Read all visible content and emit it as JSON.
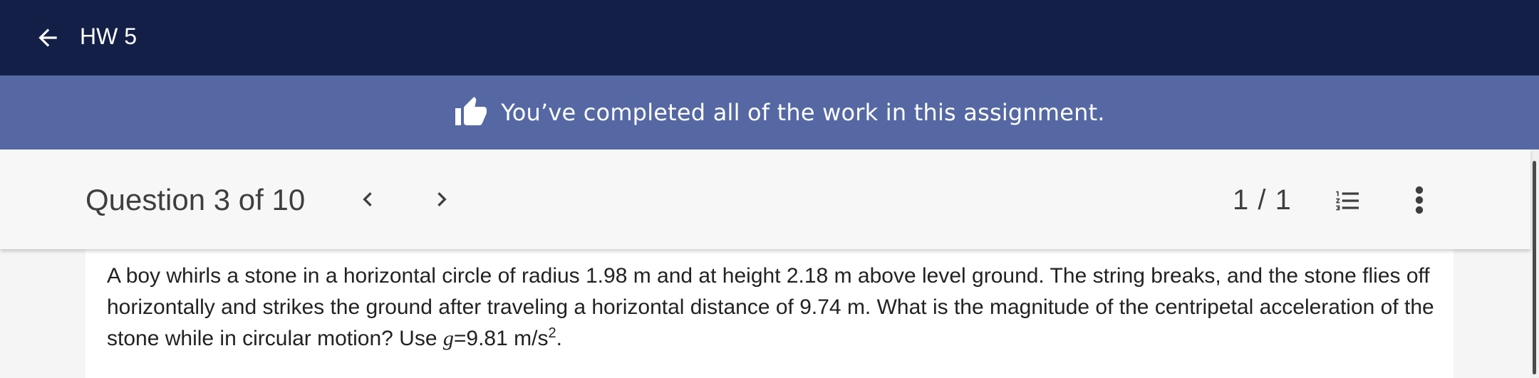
{
  "header": {
    "back_icon": "arrow-left-icon",
    "title": "HW 5"
  },
  "banner": {
    "icon": "thumbs-up-icon",
    "message": "You’ve completed all of the work in this assignment."
  },
  "question_bar": {
    "title": "Question 3 of 10",
    "prev_icon": "chevron-left-icon",
    "next_icon": "chevron-right-icon",
    "page_count": "1 / 1",
    "list_icon": "numbered-list-icon",
    "more_icon": "more-vertical-icon"
  },
  "question": {
    "text_main": "A boy whirls a stone in a horizontal circle of radius 1.98 m and at height 2.18 m above level ground. The string breaks, and the stone flies off horizontally and strikes the ground after traveling a horizontal distance of 9.74 m. What is the magnitude of the centripetal acceleration of the stone while in circular motion? Use ",
    "gravity_var": "g",
    "gravity_value": "=9.81 m/s",
    "gravity_exp": "2",
    "end": "."
  },
  "colors": {
    "topbar": "#141f48",
    "banner": "#5568a3",
    "toolbar": "#f7f7f7",
    "text": "#222222"
  }
}
